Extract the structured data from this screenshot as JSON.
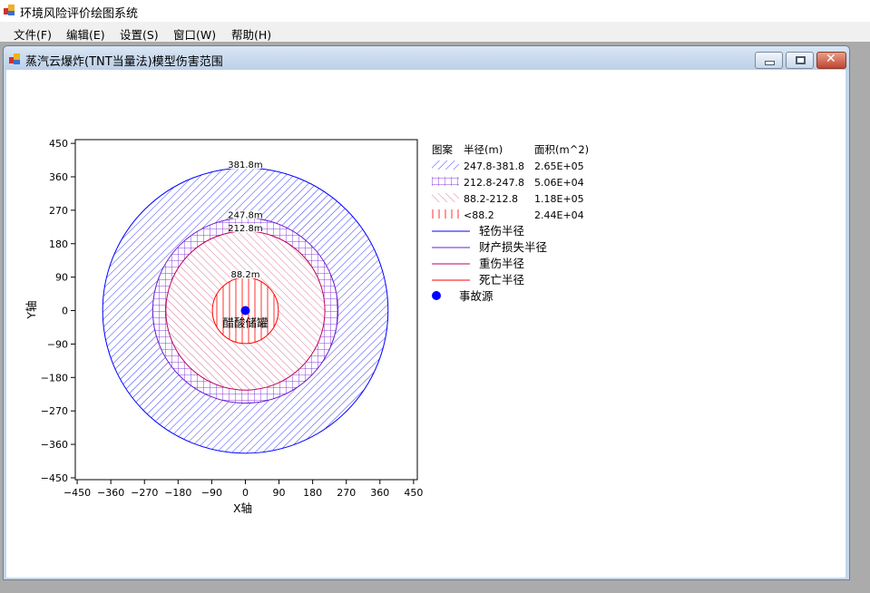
{
  "app": {
    "title": "环境风险评价绘图系统"
  },
  "menu": [
    {
      "label": "文件(F)"
    },
    {
      "label": "编辑(E)"
    },
    {
      "label": "设置(S)"
    },
    {
      "label": "窗口(W)"
    },
    {
      "label": "帮助(H)"
    }
  ],
  "child": {
    "title": "蒸汽云爆炸(TNT当量法)模型伤害范围"
  },
  "chart_data": {
    "type": "scatter",
    "xlabel": "X轴",
    "ylabel": "Y轴",
    "xlim": [
      -455,
      460
    ],
    "ylim": [
      -455,
      460
    ],
    "xticks": [
      -450,
      -360,
      -270,
      -180,
      -90,
      0,
      90,
      180,
      270,
      360,
      450
    ],
    "yticks": [
      -450,
      -360,
      -270,
      -180,
      -90,
      0,
      90,
      180,
      270,
      360,
      450
    ],
    "circles": [
      {
        "radius": 381.8,
        "label": "381.8m",
        "color": "#0000ff",
        "pattern": "diag-blue"
      },
      {
        "radius": 247.8,
        "label": "247.8m",
        "color": "#6a1fd0",
        "pattern": "grid-purple"
      },
      {
        "radius": 212.8,
        "label": "212.8m",
        "color": "#c0005a",
        "pattern": "back-pink"
      },
      {
        "radius": 88.2,
        "label": "88.2m",
        "color": "#ff0000",
        "pattern": "vert-red"
      }
    ],
    "source": {
      "x": 0,
      "y": 0,
      "label": "醋酸储罐",
      "color": "#0000ff"
    },
    "legend": {
      "header": [
        "图案",
        "半径(m)",
        "面积(m^2)"
      ],
      "patterns": [
        {
          "range": "247.8-381.8",
          "area": "2.65E+05",
          "pattern": "diag-blue"
        },
        {
          "range": "212.8-247.8",
          "area": "5.06E+04",
          "pattern": "grid-purple"
        },
        {
          "range": "88.2-212.8",
          "area": "1.18E+05",
          "pattern": "back-pink"
        },
        {
          "range": "<88.2",
          "area": "2.44E+04",
          "pattern": "vert-red"
        }
      ],
      "lines": [
        {
          "label": "轻伤半径",
          "color": "#0000ff"
        },
        {
          "label": "财产损失半径",
          "color": "#6a1fd0"
        },
        {
          "label": "重伤半径",
          "color": "#c0005a"
        },
        {
          "label": "死亡半径",
          "color": "#ff0000"
        }
      ],
      "source_label": "事故源"
    }
  }
}
